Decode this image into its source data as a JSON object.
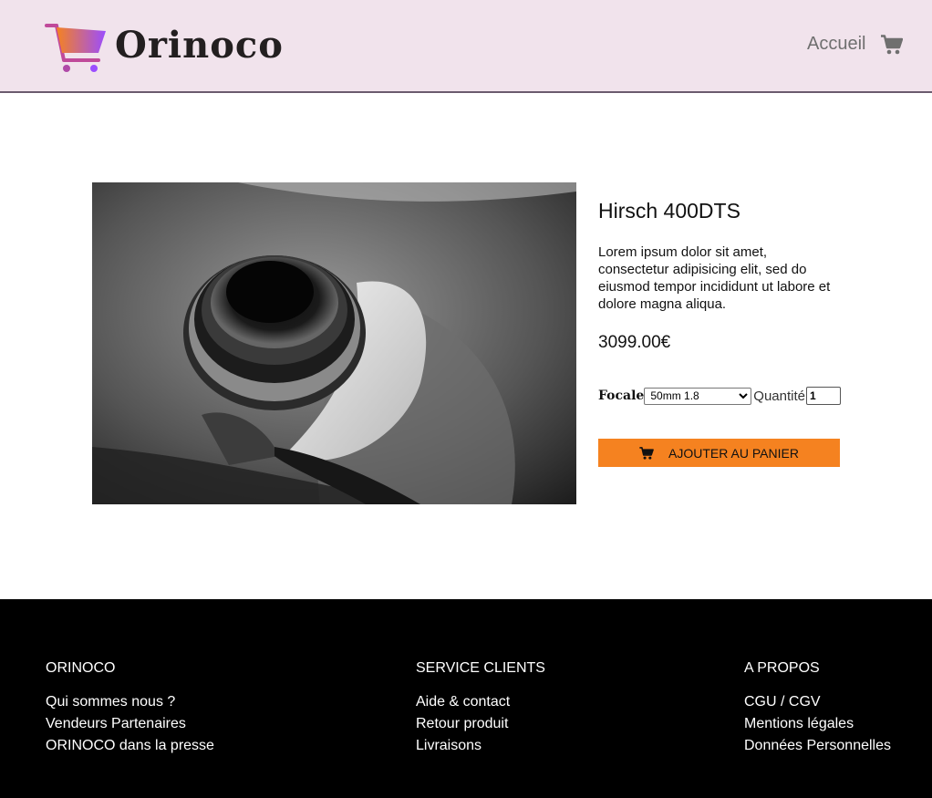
{
  "brand": {
    "name": "Orinoco",
    "colors": {
      "header_bg": "#f1e3ec",
      "accent_orange": "#f58220",
      "logo_gradient_start": "#f58220",
      "logo_gradient_end": "#9b4dff"
    }
  },
  "header": {
    "nav_home": "Accueil",
    "cart_icon": "cart-icon"
  },
  "product": {
    "name": "Hirsch 400DTS",
    "description": "Lorem ipsum dolor sit amet, consectetur adipisicing elit, sed do eiusmod tempor incididunt ut labore et dolore magna aliqua.",
    "price": "3099.00€",
    "focale_label": "Focale",
    "focale_selected": "50mm 1.8",
    "quantity_label": "Quantité",
    "quantity_value": "1",
    "add_button_label": "AJOUTER AU PANIER"
  },
  "footer": {
    "columns": [
      {
        "title": "ORINOCO",
        "links": [
          "Qui sommes nous ?",
          "Vendeurs Partenaires",
          "ORINOCO dans la presse"
        ]
      },
      {
        "title": "SERVICE CLIENTS",
        "links": [
          "Aide & contact",
          "Retour produit",
          "Livraisons"
        ]
      },
      {
        "title": "A PROPOS",
        "links": [
          "CGU / CGV",
          "Mentions légales",
          "Données Personnelles"
        ]
      }
    ]
  }
}
